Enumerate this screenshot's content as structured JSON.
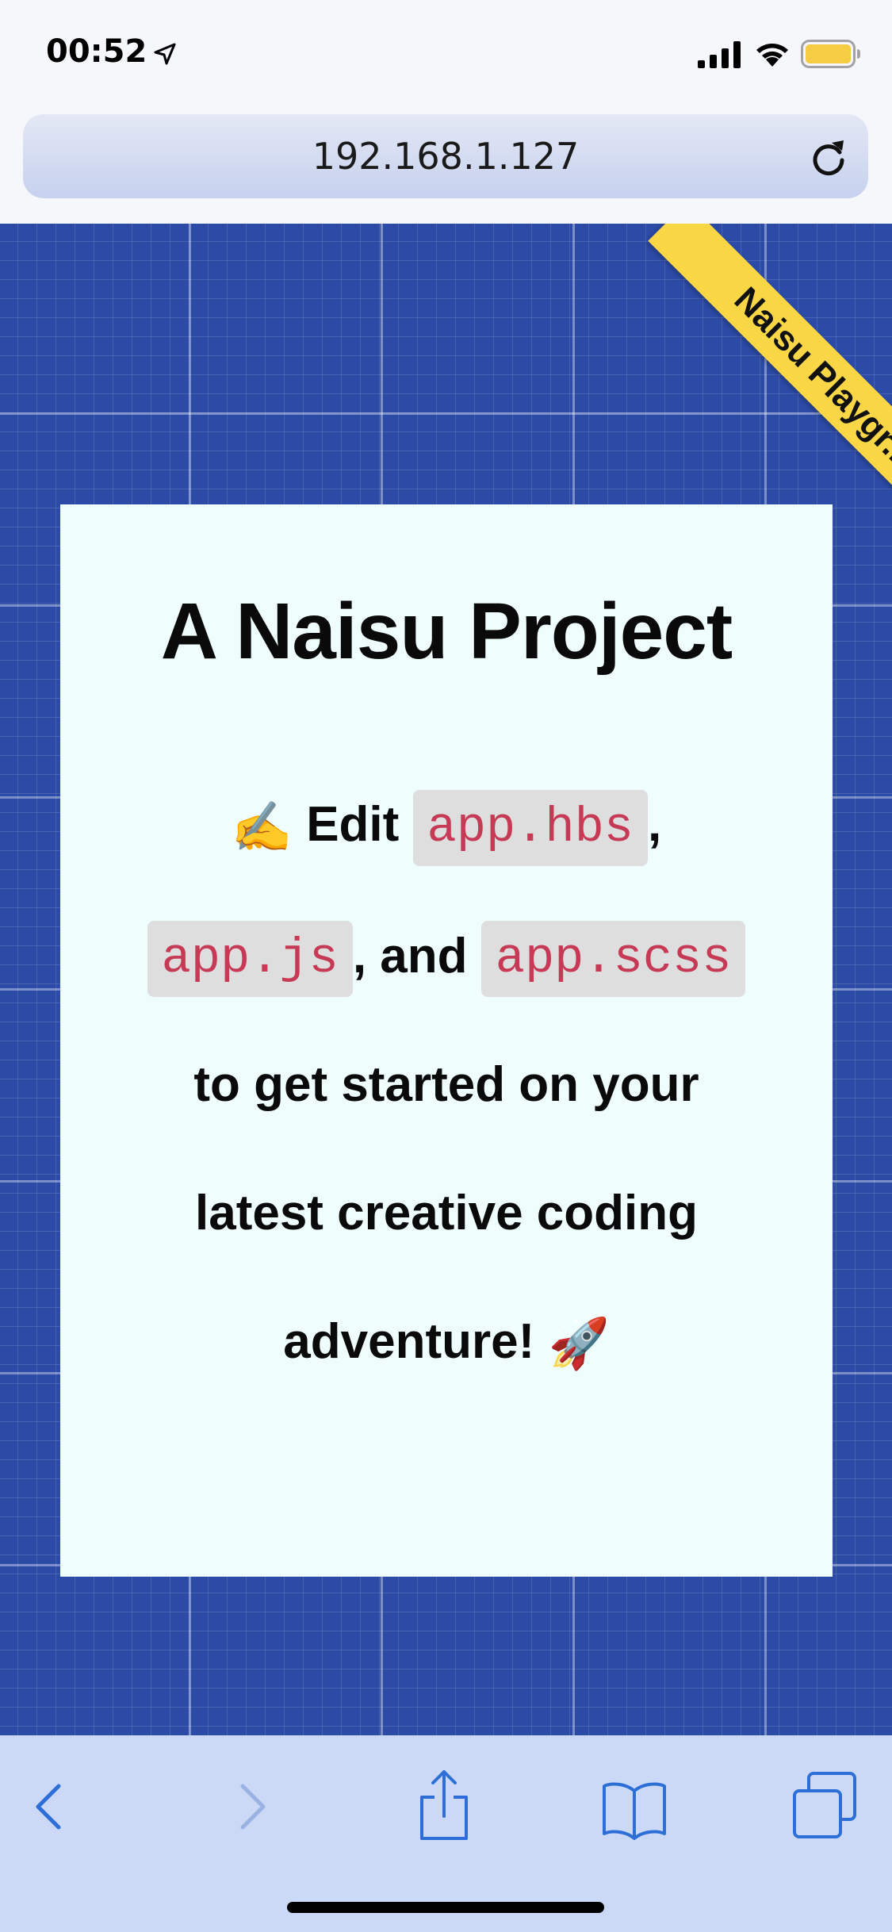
{
  "status_bar": {
    "time": "00:52",
    "location_icon": "location-arrow-icon",
    "signal_icon": "cellular-signal-icon",
    "wifi_icon": "wifi-icon",
    "battery_icon": "battery-icon",
    "battery_color": "#f4cd45"
  },
  "browser": {
    "url": "192.168.1.127",
    "reload_icon": "reload-icon"
  },
  "page": {
    "ribbon": "Naisu Playgr...",
    "title": "A Naisu Project",
    "body": {
      "emoji_start": "✍️",
      "edit": "Edit",
      "file1": "app.hbs",
      "comma": ",",
      "file2": "app.js",
      "and": ", and",
      "file3": "app.scss",
      "rest": "to get started on your latest creative coding adventure!",
      "emoji_end": "🚀"
    },
    "colors": {
      "background": "#2c4ba6",
      "ribbon": "#f9d646",
      "card": "#f0fdfd",
      "code_text": "#c73a56",
      "code_bg": "#dedede"
    }
  },
  "toolbar": {
    "back_icon": "back-chevron-icon",
    "forward_icon": "forward-chevron-icon",
    "share_icon": "share-icon",
    "bookmarks_icon": "book-icon",
    "tabs_icon": "tabs-icon",
    "accent": "#2d6fd6"
  }
}
